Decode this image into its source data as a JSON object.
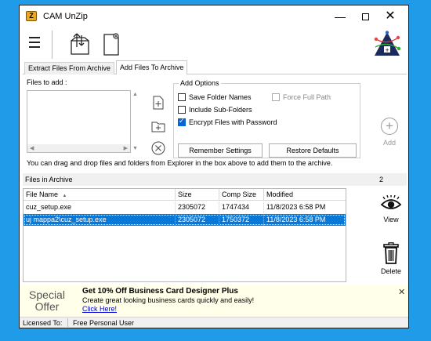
{
  "window": {
    "title": "CAM UnZip",
    "app_icon_glyph": "Z"
  },
  "title_controls": {
    "minimize": "—",
    "close": "✕"
  },
  "toolbar": {
    "icons": [
      "hamburger-menu-icon",
      "open-archive-icon",
      "new-archive-icon",
      "cam-logo-icon"
    ]
  },
  "tabs": [
    {
      "label": "Extract Files From Archive",
      "active": false
    },
    {
      "label": "Add Files To Archive",
      "active": true
    }
  ],
  "add_panel": {
    "files_label": "Files to add :",
    "options_title": "Add Options",
    "options": {
      "save_folder_names": {
        "label": "Save Folder Names",
        "checked": false
      },
      "include_subfolders": {
        "label": "Include Sub-Folders",
        "checked": false
      },
      "encrypt": {
        "label": "Encrypt Files with Password",
        "checked": true
      },
      "force_full_path": {
        "label": "Force Full Path",
        "checked": false,
        "disabled": true
      }
    },
    "remember_button": "Remember Settings",
    "restore_button": "Restore Defaults",
    "add_label": "Add",
    "hint": "You can drag and drop files and folders from Explorer in the box above to add them to the archive."
  },
  "archive": {
    "title": "Files in Archive",
    "count": "2",
    "columns": [
      "File Name",
      "Size",
      "Comp Size",
      "Modified"
    ],
    "sort_arrow": "▲",
    "rows": [
      {
        "name": "cuz_setup.exe",
        "size": "2305072",
        "comp": "1747434",
        "modified": "11/8/2023 6:58 PM",
        "selected": false
      },
      {
        "name": "uj mappa2\\cuz_setup.exe",
        "size": "2305072",
        "comp": "1750372",
        "modified": "11/8/2023 6:58 PM",
        "selected": true
      }
    ],
    "view_label": "View",
    "delete_label": "Delete"
  },
  "offer": {
    "special": "Special\nOffer",
    "special_line1": "Special",
    "special_line2": "Offer",
    "title": "Get 10% Off Business Card Designer Plus",
    "desc": "Create great looking business cards quickly and easily!",
    "link": "Click Here!",
    "close": "✕"
  },
  "status": {
    "label": "Licensed To:",
    "value": "Free Personal User"
  },
  "colors": {
    "background": "#1f9be8",
    "selection": "#0a78d7",
    "offer_bg": "#ffffea",
    "link": "#0000cc"
  }
}
